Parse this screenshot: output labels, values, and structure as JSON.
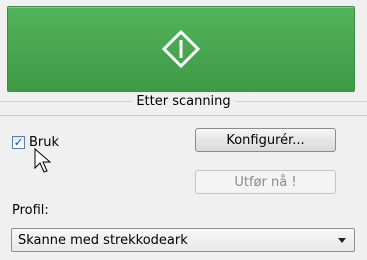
{
  "colors": {
    "scan_button": "#46a44e",
    "background": "#f0f0f0"
  },
  "scan_button": {
    "icon": "scan-diamond-icon"
  },
  "section": {
    "title": "Etter scanning"
  },
  "use_checkbox": {
    "label": "Bruk",
    "checked": true
  },
  "buttons": {
    "configure": "Konfigurér...",
    "run_now": "Utfør nå !"
  },
  "profile": {
    "label": "Profil:",
    "selected": "Skanne med strekkodeark"
  }
}
